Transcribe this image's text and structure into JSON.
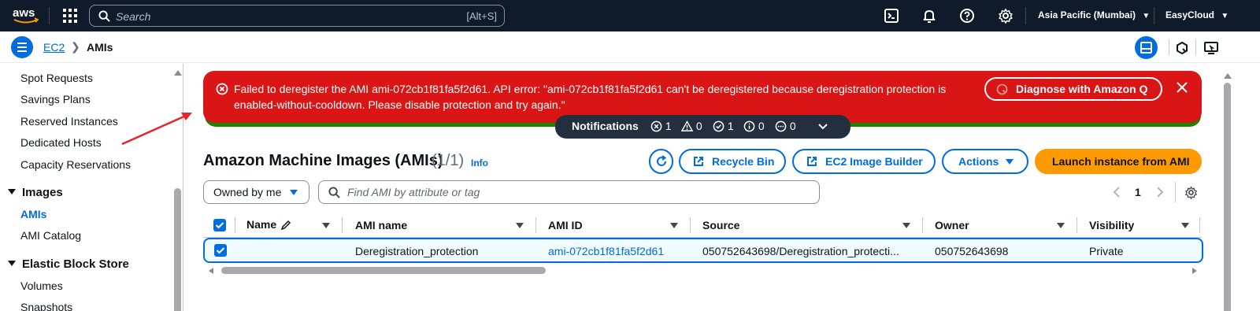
{
  "topnav": {
    "logo": "aws",
    "search_placeholder": "Search",
    "search_shortcut": "[Alt+S]",
    "region": "Asia Pacific (Mumbai)",
    "account": "EasyCloud"
  },
  "breadcrumb": {
    "service": "EC2",
    "current": "AMIs"
  },
  "sidebar": {
    "items_top": [
      "Spot Requests",
      "Savings Plans",
      "Reserved Instances",
      "Dedicated Hosts",
      "Capacity Reservations"
    ],
    "section_images": "Images",
    "images_items": [
      "AMIs",
      "AMI Catalog"
    ],
    "section_ebs": "Elastic Block Store",
    "ebs_items": [
      "Volumes",
      "Snapshots"
    ]
  },
  "flash": {
    "message": "Failed to deregister the AMI ami-072cb1f81fa5f2d61. API error: \"ami-072cb1f81fa5f2d61 can't be deregistered because deregistration protection is enabled-without-cooldown. Please disable protection and try again.\"",
    "diagnose_label": "Diagnose with Amazon Q"
  },
  "notifications": {
    "label": "Notifications",
    "error_count": "1",
    "warning_count": "0",
    "success_count": "1",
    "info_count": "0",
    "progress_count": "0"
  },
  "header": {
    "title": "Amazon Machine Images (AMIs)",
    "count": "(1/1)",
    "info": "Info",
    "recycle_bin": "Recycle Bin",
    "image_builder": "EC2 Image Builder",
    "actions": "Actions",
    "launch": "Launch instance from AMI"
  },
  "filters": {
    "owned": "Owned by me",
    "find_placeholder": "Find AMI by attribute or tag",
    "page": "1"
  },
  "table": {
    "columns": [
      "Name",
      "AMI name",
      "AMI ID",
      "Source",
      "Owner",
      "Visibility"
    ],
    "rows": [
      {
        "name": "",
        "ami_name": "Deregistration_protection",
        "ami_id": "ami-072cb1f81fa5f2d61",
        "source": "050752643698/Deregistration_protecti...",
        "owner": "050752643698",
        "visibility": "Private"
      }
    ]
  },
  "colors": {
    "nav_bg": "#0f1b2a",
    "link": "#006ce0",
    "error": "#d91515",
    "primary": "#ff9900",
    "annotation_arrow": "#e8222a"
  }
}
